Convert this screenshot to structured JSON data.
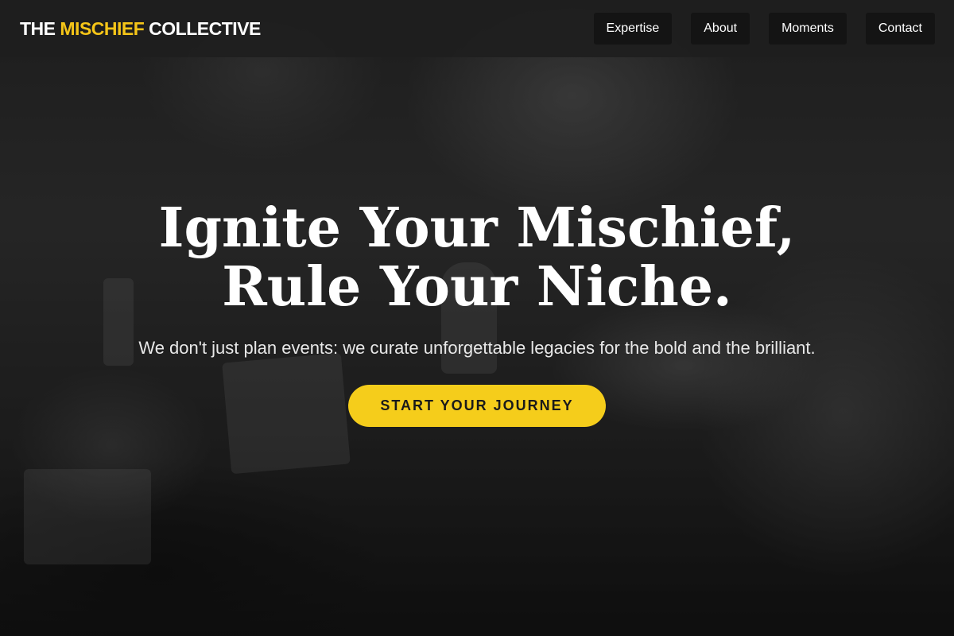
{
  "header": {
    "logo": {
      "part1": "THE ",
      "accent": "MISCHIEF",
      "part2": " COLLECTIVE"
    },
    "nav": [
      {
        "label": "Expertise"
      },
      {
        "label": "About"
      },
      {
        "label": "Moments"
      },
      {
        "label": "Contact"
      }
    ]
  },
  "hero": {
    "title": "Ignite Your Mischief, Rule Your Niche.",
    "subtitle": "We don't just plan events: we curate unforgettable legacies for the bold and the brilliant.",
    "cta_label": "START YOUR JOURNEY"
  },
  "colors": {
    "accent": "#f5c518",
    "header_bg": "#1e1e1e",
    "nav_button_bg": "#141414",
    "cta_bg": "#f5cd1b"
  }
}
